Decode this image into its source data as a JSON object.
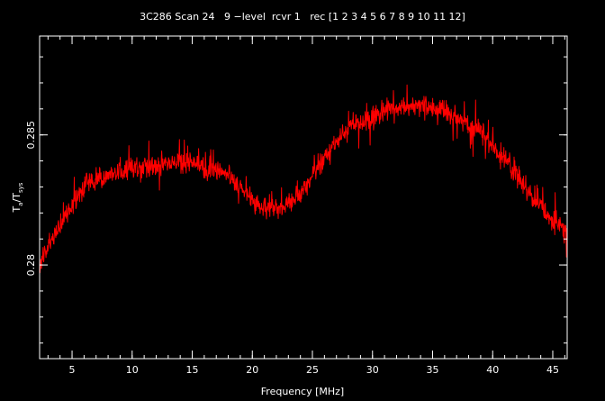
{
  "chart_data": {
    "type": "line",
    "title": "3C286 Scan 24   9 −level  rcvr 1   rec [1 2 3 4 5 6 7 8 9 10 11 12]",
    "xlabel": "Frequency [MHz]",
    "ylabel": {
      "base_T": "T",
      "sub_a": "a",
      "slash": "/T",
      "sub_sys": "sys"
    },
    "xlim": [
      2.3,
      46.2
    ],
    "ylim": [
      0.2764,
      0.2888
    ],
    "x_ticks": [
      {
        "v": 5,
        "label": "5"
      },
      {
        "v": 10,
        "label": "10"
      },
      {
        "v": 15,
        "label": "15"
      },
      {
        "v": 20,
        "label": "20"
      },
      {
        "v": 25,
        "label": "25"
      },
      {
        "v": 30,
        "label": "30"
      },
      {
        "v": 35,
        "label": "35"
      },
      {
        "v": 40,
        "label": "40"
      },
      {
        "v": 45,
        "label": "45"
      }
    ],
    "y_ticks": [
      {
        "v": 0.28,
        "label": "0.28"
      },
      {
        "v": 0.285,
        "label": "0.285"
      }
    ],
    "x_minor_step": 1,
    "y_minor_step": 0.001,
    "grid": false,
    "colors": {
      "background": "#000000",
      "axes": "#ffffff",
      "line": "#ff0000",
      "text": "#ffffff"
    },
    "series": [
      {
        "x": [
          2.3,
          3,
          4,
          5,
          6,
          7,
          8,
          9,
          10,
          11,
          12,
          13,
          14,
          15,
          16,
          17,
          18,
          19,
          20,
          21,
          22,
          23,
          24,
          25,
          26,
          27,
          28,
          29,
          30,
          31,
          32,
          33,
          34,
          35,
          36,
          37,
          38,
          39,
          40,
          41,
          42,
          43,
          44,
          45,
          46.2
        ],
        "values": [
          0.28,
          0.2807,
          0.2815,
          0.2823,
          0.283,
          0.2833,
          0.2834,
          0.2836,
          0.2837,
          0.2838,
          0.2838,
          0.2839,
          0.284,
          0.2839,
          0.2838,
          0.2837,
          0.2834,
          0.283,
          0.2825,
          0.2822,
          0.2822,
          0.2823,
          0.2827,
          0.2834,
          0.2841,
          0.2847,
          0.2852,
          0.2855,
          0.2857,
          0.2859,
          0.286,
          0.2861,
          0.2861,
          0.286,
          0.2859,
          0.2857,
          0.2854,
          0.2851,
          0.2846,
          0.2841,
          0.2835,
          0.2828,
          0.2822,
          0.2817,
          0.2812
        ],
        "noise_amplitude": 0.0006
      }
    ]
  }
}
